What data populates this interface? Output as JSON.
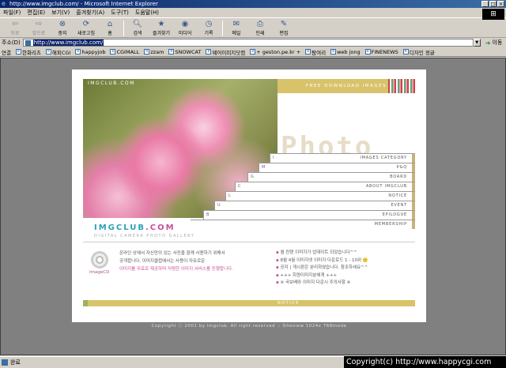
{
  "window": {
    "title": "http://www.imgclub.com/ - Microsoft Internet Explorer",
    "min": "_",
    "max": "□",
    "close": "×"
  },
  "menu": [
    "파일(F)",
    "편집(E)",
    "보기(V)",
    "즐겨찾기(A)",
    "도구(T)",
    "도움말(H)"
  ],
  "toolbar": {
    "back": "뒤로",
    "forward": "앞으로",
    "stop": "중지",
    "refresh": "새로고침",
    "home": "홈",
    "search": "검색",
    "favorites": "즐겨찾기",
    "media": "미디어",
    "history": "기록",
    "mail": "메일",
    "print": "인쇄",
    "edit": "편집"
  },
  "address": {
    "label": "주소(D)",
    "url": "http://www.imgclub.com/",
    "go": "이동"
  },
  "links": {
    "label": "연결",
    "items": [
      "한화리츠",
      "해피CGI",
      "happyjob",
      "CGIMALL",
      "zzam",
      "SNOWCAT",
      "웨어이미지닷컴",
      "+ geston.pe.kr +",
      "탐여리",
      "web jong",
      "FINENEWS",
      "디자인 정글"
    ]
  },
  "site": {
    "photo_logo": "IMGCLUB.COM",
    "banner": "FREE DOWNLOAD IMAGES",
    "photo_word": "Photo",
    "menu": [
      {
        "key": "I",
        "label": "IMAGES CATEGORY"
      },
      {
        "key": "M",
        "label": "P&Q"
      },
      {
        "key": "G",
        "label": "BOARD"
      },
      {
        "key": "C",
        "label": "ABOUT IMGCLUB"
      },
      {
        "key": "L",
        "label": "NOTICE"
      },
      {
        "key": "U",
        "label": "EVENT"
      },
      {
        "key": "B",
        "label": "EPILOGUE"
      },
      {
        "key": "",
        "label": "MEMBERSHIP"
      }
    ],
    "brand_a": "IMGCLUB",
    "brand_b": ".COM",
    "brand_sub": "DIGITAL CAMERA PHOTO GALLERY",
    "cd_label": "ImageCD",
    "intro_1": "온라인 상에서 자신만의 있는 사진을 함께 사용하기 위해서",
    "intro_2": "공개합니다. 이미지클럽에서는 사용이 자유로운",
    "intro_hl1": "이미지를 무료로 제공하며",
    "intro_hl2": "저렴한 이미지 서비스를 진행합니다.",
    "notices": [
      "월 컨텐 이미지가 업데이트 되었습니다^^",
      "8월 4월 이미지넷 이미지 다운로드 1 - 10위 🙂",
      "공지 | 게시판은 분리하였습니다. 참조하세요^^",
      "+++ 회원이미지분에게 +++",
      "※ 국보배와 이미지 다운시 주의사항 ※"
    ],
    "notice_bar": "NOTICE",
    "footer": "Copyright ⓒ 2001 by imgclub. All right reserved  ::  Siteview 1024x 768mode"
  },
  "status": {
    "text": "완료",
    "watermark": "Copyright(c) http://www.happycgi.com"
  }
}
